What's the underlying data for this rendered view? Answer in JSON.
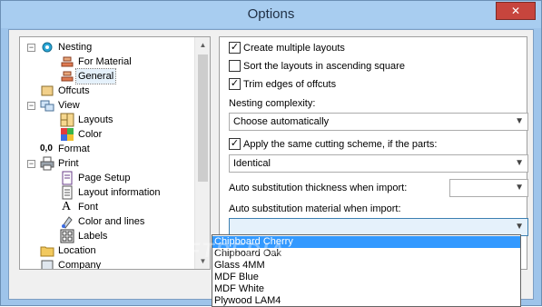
{
  "window": {
    "title": "Options",
    "close_glyph": "✕"
  },
  "tree": {
    "items": [
      {
        "label": "Nesting",
        "icon": "gear-icon"
      },
      {
        "label": "For Material",
        "icon": "material-icon"
      },
      {
        "label": "General",
        "icon": "material-icon"
      },
      {
        "label": "Offcuts",
        "icon": "offcuts-icon"
      },
      {
        "label": "View",
        "icon": "view-icon"
      },
      {
        "label": "Layouts",
        "icon": "layouts-icon"
      },
      {
        "label": "Color",
        "icon": "color-icon"
      },
      {
        "label": "Format",
        "icon": "format-icon",
        "prefix": "0,0"
      },
      {
        "label": "Print",
        "icon": "printer-icon"
      },
      {
        "label": "Page Setup",
        "icon": "page-icon"
      },
      {
        "label": "Layout information",
        "icon": "document-icon"
      },
      {
        "label": "Font",
        "icon": "font-icon",
        "glyph": "A"
      },
      {
        "label": "Color and lines",
        "icon": "paint-icon"
      },
      {
        "label": "Labels",
        "icon": "labels-icon"
      },
      {
        "label": "Location",
        "icon": "folder-icon"
      },
      {
        "label": "Company",
        "icon": "company-icon"
      }
    ]
  },
  "options": {
    "create_multiple_layouts": {
      "label": "Create multiple layouts",
      "checked": true
    },
    "sort_layouts": {
      "label": "Sort the layouts in ascending square",
      "checked": false
    },
    "trim_edges": {
      "label": "Trim edges of offcuts",
      "checked": true
    },
    "nesting_complexity_label": "Nesting complexity:",
    "nesting_complexity_value": "Choose automatically",
    "same_cutting_scheme": {
      "label": "Apply the same cutting scheme, if the parts:",
      "checked": true
    },
    "same_cutting_scheme_value": "Identical",
    "auto_thickness_label": "Auto substitution thickness when import:",
    "auto_thickness_value": "",
    "auto_material_label": "Auto substitution material when import:",
    "auto_material_value": ""
  },
  "dropdown": {
    "items": [
      "Chipboard Cherry",
      "Chipboard Oak",
      "Glass 4MM",
      "MDF Blue",
      "MDF White",
      "Plywood LAM4"
    ],
    "highlighted_index": 0
  },
  "watermark": "SOFTPEDIA",
  "colors": {
    "titlebar": "#a8cdf0",
    "close": "#c7453d",
    "highlight": "#3399ff"
  }
}
